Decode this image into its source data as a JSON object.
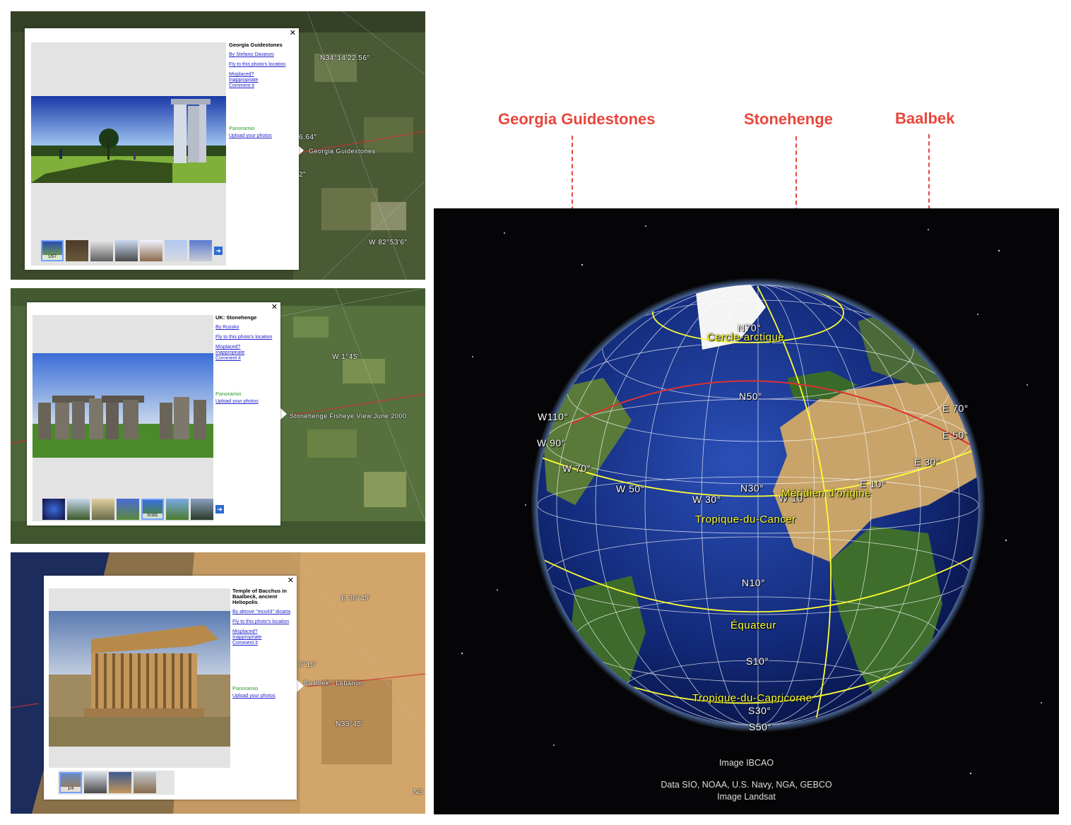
{
  "callouts": {
    "georgia": "Georgia Guidestones",
    "stonehenge": "Stonehenge",
    "baalbek": "Baalbek"
  },
  "panels": [
    {
      "title": "Georgia Guidestones",
      "author": "By Stefano Davanzo",
      "fly": "Fly to this photo's location",
      "misplaced": "Misplaced?",
      "inappropriate": "Inappropriate",
      "comment": "Comment it",
      "brand": "Panoramio",
      "upload": "Upload your photos",
      "counter": "1/57",
      "place_label": "Georgia Guidestones",
      "coords": [
        "N34°14'22.56\"",
        "6.64\"",
        "2\"",
        "W 82°53'6\""
      ]
    },
    {
      "title": "UK: Stonehenge",
      "author": "By Russko",
      "fly": "Fly to this photo's location",
      "misplaced": "Misplaced?",
      "inappropriate": "Inappropriate",
      "comment": "Comment it",
      "brand": "Panoramio",
      "upload": "Upload your photos",
      "counter": "5/181",
      "place_label": "Stonehenge Fisheye View June 2000",
      "coords": [
        "W 1°45'"
      ]
    },
    {
      "title": "Temple of Bacchus in Baalbeck, ancient Heliopolis",
      "author": "By altrove \"mco43\" dicarta",
      "fly": "Fly to this photo's location",
      "misplaced": "Misplaced?",
      "inappropriate": "Inappropriate",
      "comment": "Comment it",
      "brand": "Panoramio",
      "upload": "Upload your photos",
      "counter": "1/4",
      "place_label": "Baalbek - Lebanon",
      "coords": [
        "E 36°45'",
        "6°15'",
        "N33°45'",
        "N3"
      ]
    }
  ],
  "globe": {
    "labels": {
      "w110": "W110°",
      "w90": "W 90°",
      "w70": "W 70°",
      "w50": "W 50°",
      "w30": "W 30°",
      "w10": "W 10°",
      "e10": "E 10°",
      "e30": "E 30°",
      "e50": "E 50°",
      "e70": "E 70°",
      "n70": "N70°",
      "n50": "N50°",
      "n30": "N30°",
      "n10": "N10°",
      "s10": "S10°",
      "s30": "S30°",
      "s50": "S50°",
      "arctic": "Cercle-arctique",
      "meridian": "Méridien d'origine",
      "cancer": "Tropique-du-Cancer",
      "equator": "Équateur",
      "capricorn": "Tropique-du-Capricorne"
    },
    "credits": {
      "line1": "Image IBCAO",
      "line2": "Data SIO, NOAA, U.S. Navy, NGA, GEBCO",
      "line3": "Image Landsat"
    }
  },
  "colors": {
    "callout_red": "#e8463c",
    "grid_yellow": "#ffff33",
    "link_blue": "#2222cc"
  }
}
